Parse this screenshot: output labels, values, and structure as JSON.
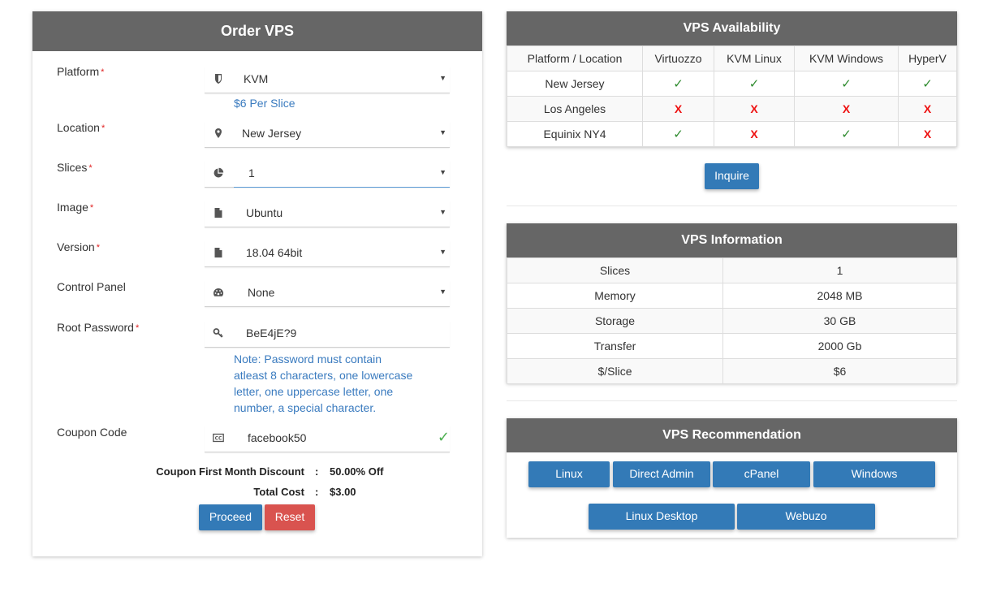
{
  "order": {
    "title": "Order VPS",
    "fields": [
      {
        "label": "Platform",
        "required": "*",
        "icon": "shield-icon",
        "value": "KVM",
        "type": "select"
      },
      {
        "label": "Location",
        "required": "*",
        "icon": "map-marker-icon",
        "value": "New Jersey",
        "type": "select"
      },
      {
        "label": "Slices",
        "required": "*",
        "icon": "pie-chart-icon",
        "value": "1",
        "type": "select"
      },
      {
        "label": "Image",
        "required": "*",
        "icon": "file-icon",
        "value": "Ubuntu",
        "type": "select"
      },
      {
        "label": "Version",
        "required": "*",
        "icon": "file-icon",
        "value": "18.04 64bit",
        "type": "select"
      },
      {
        "label": "Control Panel",
        "required": "",
        "icon": "dashboard-icon",
        "value": "None",
        "type": "select"
      },
      {
        "label": "Root Password",
        "required": "*",
        "icon": "key-icon",
        "value": "BeE4jE?9",
        "type": "text"
      },
      {
        "label": "Coupon Code",
        "required": "",
        "icon": "cc-icon",
        "value": "facebook50",
        "type": "text"
      }
    ],
    "platform_hint": "$6 Per Slice",
    "password_note": [
      "Note: Password must contain",
      "atleast 8 characters, one lowercase",
      "letter, one uppercase letter, one",
      "number, a special character."
    ],
    "caret": "▼",
    "valid_check": "✓",
    "discount_label": "Coupon First Month Discount",
    "discount_value": "50.00% Off",
    "total_label": "Total Cost",
    "total_value": "$3.00",
    "colon": ":",
    "proceed_label": "Proceed",
    "reset_label": "Reset"
  },
  "availability": {
    "title": "VPS Availability",
    "headers": [
      "Platform / Location",
      "Virtuozzo",
      "KVM Linux",
      "KVM Windows",
      "HyperV"
    ],
    "rows": [
      {
        "location": "New Jersey",
        "cells": [
          "yes",
          "yes",
          "yes",
          "yes"
        ]
      },
      {
        "location": "Los Angeles",
        "cells": [
          "no",
          "no",
          "no",
          "no"
        ]
      },
      {
        "location": "Equinix NY4",
        "cells": [
          "yes",
          "no",
          "yes",
          "no"
        ]
      }
    ],
    "yes_glyph": "✓",
    "no_glyph": "X",
    "inquire_label": "Inquire"
  },
  "information": {
    "title": "VPS Information",
    "rows": [
      {
        "key": "Slices",
        "value": "1"
      },
      {
        "key": "Memory",
        "value": "2048 MB"
      },
      {
        "key": "Storage",
        "value": "30 GB"
      },
      {
        "key": "Transfer",
        "value": "2000 Gb"
      },
      {
        "key": "$/Slice",
        "value": "$6"
      }
    ]
  },
  "recommendation": {
    "title": "VPS Recommendation",
    "buttons": [
      "Linux",
      "Direct Admin",
      "cPanel",
      "Windows",
      "Linux Desktop",
      "Webuzo"
    ]
  },
  "colors": {
    "header_bg": "#666666",
    "primary": "#337ab7",
    "danger": "#d9534f",
    "hint_text": "#3a7bbf",
    "yes": "#2e8b2e",
    "no": "#ee1111"
  }
}
